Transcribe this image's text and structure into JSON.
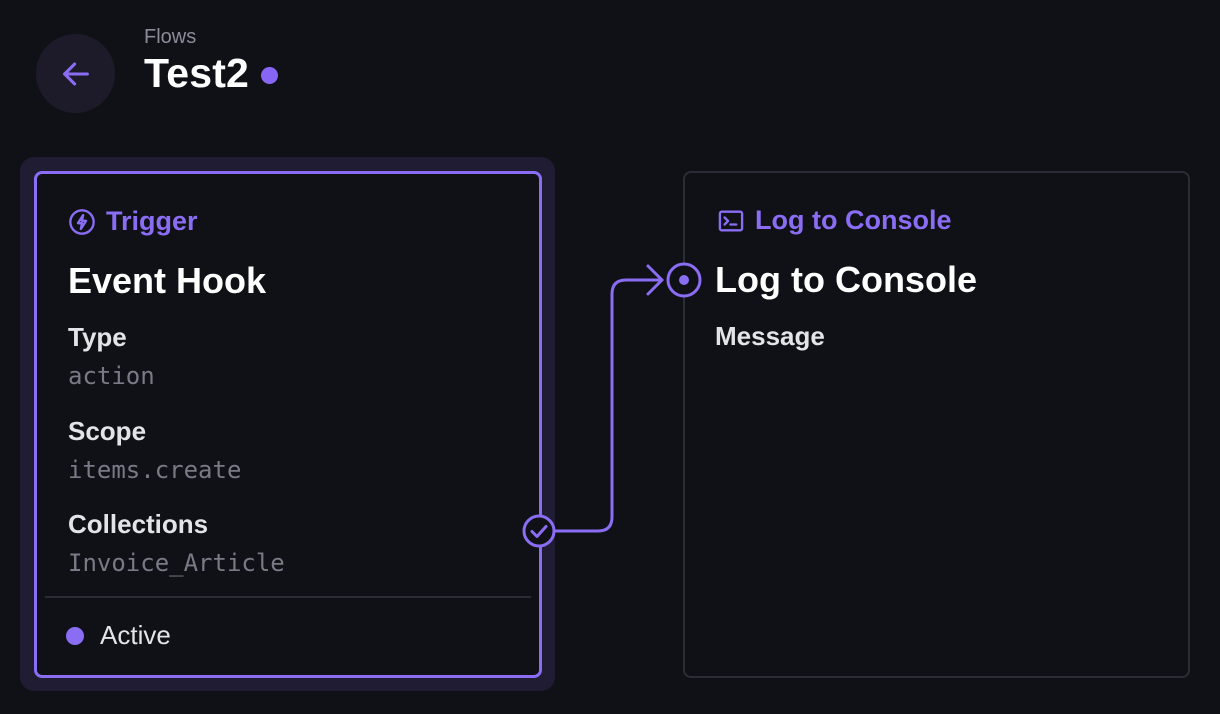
{
  "header": {
    "breadcrumb": "Flows",
    "title": "Test2"
  },
  "trigger": {
    "kind": "Trigger",
    "kind_icon": "bolt-circle-icon",
    "name": "Event Hook",
    "fields": [
      {
        "label": "Type",
        "value": "action"
      },
      {
        "label": "Scope",
        "value": "items.create"
      },
      {
        "label": "Collections",
        "value": "Invoice_Article"
      }
    ],
    "status": "Active"
  },
  "operation": {
    "kind": "Log to Console",
    "kind_icon": "terminal-icon",
    "name": "Log to Console",
    "fields": [
      {
        "label": "Message",
        "value": ""
      }
    ]
  },
  "colors": {
    "background": "#0f1116",
    "accent": "#8b6df4",
    "card_border": "#2a2d36",
    "halo": "#1f1c33"
  }
}
